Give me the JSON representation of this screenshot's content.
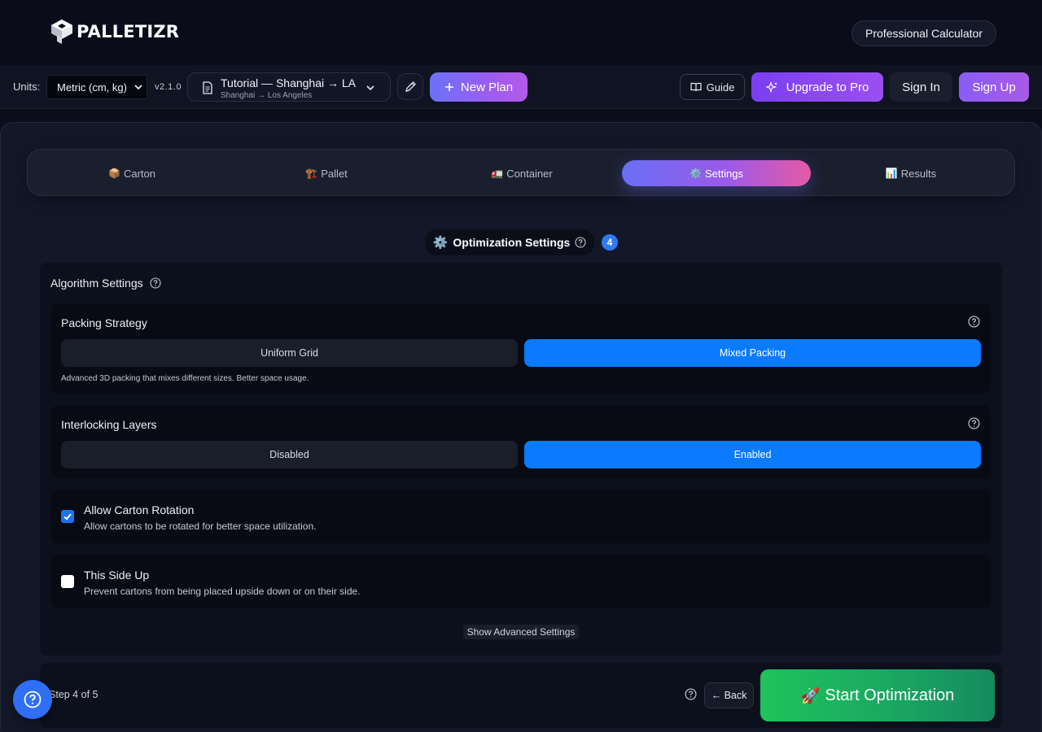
{
  "header": {
    "logo_text": "PALLETIZR",
    "pro_calc_label": "Professional Calculator"
  },
  "toolbar": {
    "units_label": "Units:",
    "units_value": "Metric (cm, kg)",
    "version": "v2.1.0",
    "plan_title": "Tutorial — Shanghai → LA",
    "plan_subtitle": "Shanghai → Los Angeles",
    "new_plan_label": "New Plan",
    "guide_label": "Guide",
    "upgrade_label": "Upgrade to Pro",
    "signin_label": "Sign In",
    "signup_label": "Sign Up"
  },
  "steps": [
    {
      "emoji": "📦",
      "label": "Carton",
      "active": false
    },
    {
      "emoji": "🏗️",
      "label": "Pallet",
      "active": false
    },
    {
      "emoji": "🚛",
      "label": "Container",
      "active": false
    },
    {
      "emoji": "⚙️",
      "label": "Settings",
      "active": true
    },
    {
      "emoji": "📊",
      "label": "Results",
      "active": false
    }
  ],
  "section": {
    "emoji": "⚙️",
    "title": "Optimization Settings",
    "badge": "4"
  },
  "algorithm": {
    "title": "Algorithm Settings",
    "packing": {
      "title": "Packing Strategy",
      "options": [
        "Uniform Grid",
        "Mixed Packing"
      ],
      "selected": "Mixed Packing",
      "hint": "Advanced 3D packing that mixes different sizes. Better space usage."
    },
    "interlocking": {
      "title": "Interlocking Layers",
      "options": [
        "Disabled",
        "Enabled"
      ],
      "selected": "Enabled"
    },
    "rotation": {
      "title": "Allow Carton Rotation",
      "description": "Allow cartons to be rotated for better space utilization.",
      "checked": true
    },
    "side_up": {
      "title": "This Side Up",
      "description": "Prevent cartons from being placed upside down or on their side.",
      "checked": false
    },
    "advanced_link": "Show Advanced Settings"
  },
  "footer": {
    "step_counter": "Step 4 of 5",
    "back_label": "← Back",
    "start_emoji": "🚀",
    "start_label": "Start Optimization"
  },
  "colors": {
    "accent_blue": "#0a7bff",
    "gradient_purple": "#9b5ae8",
    "gradient_pink": "#e65aa6",
    "start_green": "#1fc35b"
  }
}
